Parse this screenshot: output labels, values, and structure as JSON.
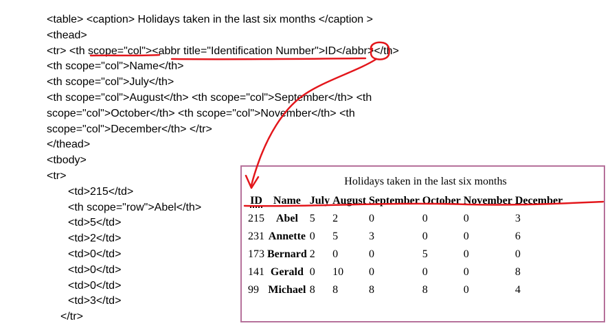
{
  "code_lines": [
    "<table> <caption> Holidays taken in the last six months </caption >",
    "<thead>",
    "<tr> <th scope=\"col\"><abbr title=\"Identification Number\">ID</abbr></th>",
    "<th scope=\"col\">Name</th>",
    "<th scope=\"col\">July</th>",
    "<th scope=\"col\">August</th> <th scope=\"col\">September</th> <th",
    "scope=\"col\">October</th> <th scope=\"col\">November</th> <th",
    "scope=\"col\">December</th> </tr>",
    "</thead>",
    "<tbody>",
    "<tr>",
    "<td>215</td>",
    "<th scope=\"row\">Abel</th>",
    "<td>5</td>",
    "<td>2</td>",
    "<td>0</td>",
    "<td>0</td>",
    "<td>0</td>",
    "<td>3</td>",
    "</tr>"
  ],
  "table": {
    "caption": "Holidays taken in the last six months",
    "headers": [
      "ID",
      "Name",
      "July",
      "August",
      "September",
      "October",
      "November",
      "December"
    ],
    "rows": [
      [
        "215",
        "Abel",
        "5",
        "2",
        "0",
        "0",
        "0",
        "3"
      ],
      [
        "231",
        "Annette",
        "0",
        "5",
        "3",
        "0",
        "0",
        "6"
      ],
      [
        "173",
        "Bernard",
        "2",
        "0",
        "0",
        "5",
        "0",
        "0"
      ],
      [
        "141",
        "Gerald",
        "0",
        "10",
        "0",
        "0",
        "0",
        "8"
      ],
      [
        "99",
        "Michael",
        "8",
        "8",
        "8",
        "8",
        "0",
        "4"
      ]
    ]
  },
  "annotation_color": "#e3161b",
  "frame_color": "#b5709a"
}
